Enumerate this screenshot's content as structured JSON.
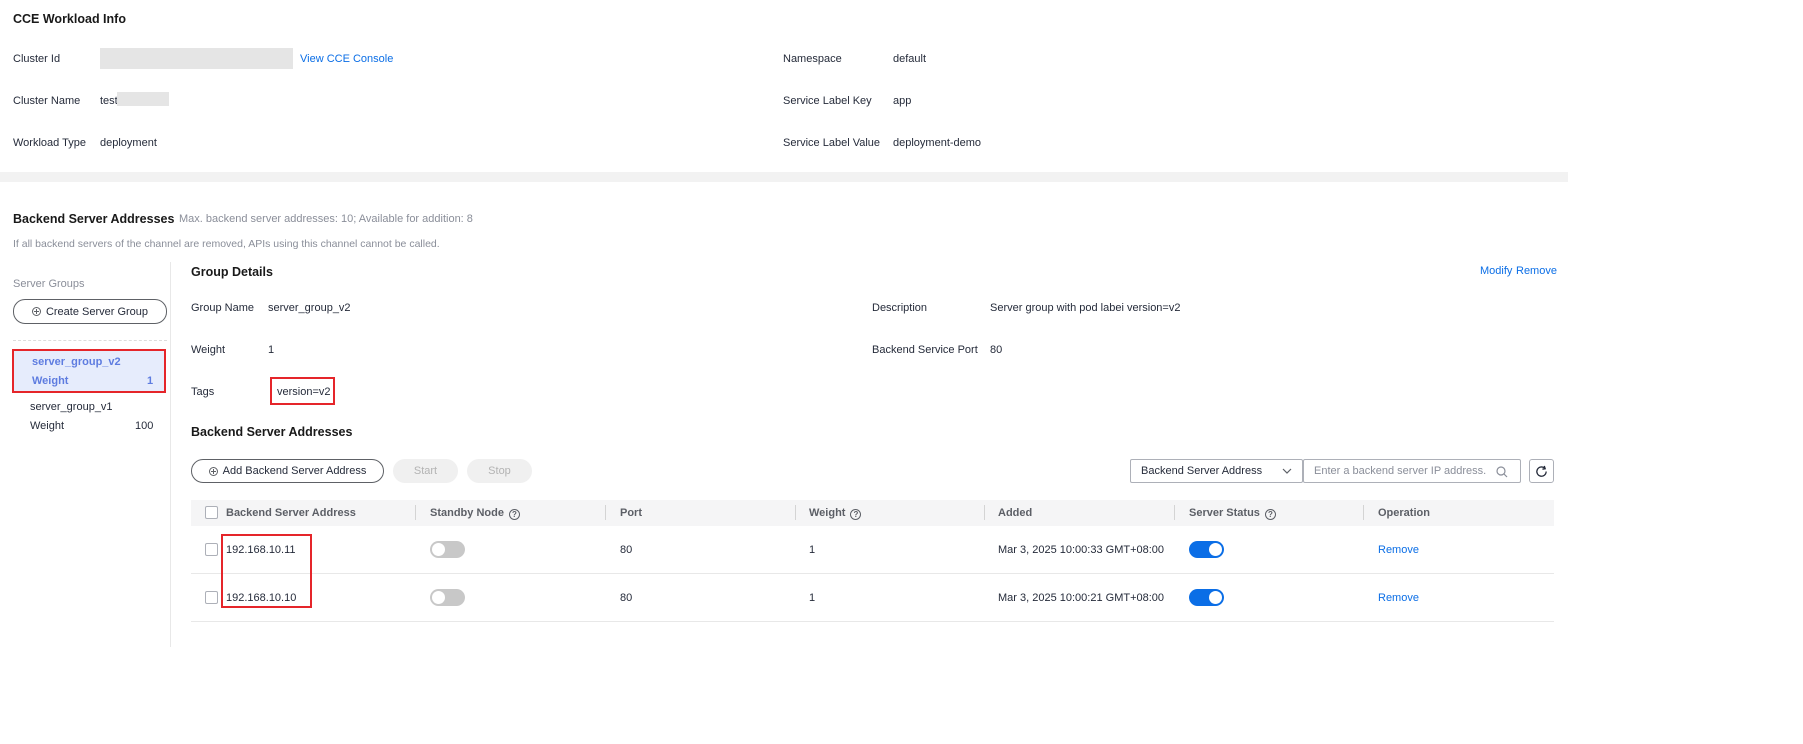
{
  "workload": {
    "title": "CCE Workload Info",
    "cluster_id_label": "Cluster Id",
    "view_console_link": "View CCE Console",
    "cluster_name_label": "Cluster Name",
    "cluster_name_value": "test",
    "workload_type_label": "Workload Type",
    "workload_type_value": "deployment",
    "namespace_label": "Namespace",
    "namespace_value": "default",
    "service_label_key_label": "Service Label Key",
    "service_label_key_value": "app",
    "service_label_value_label": "Service Label Value",
    "service_label_value_value": "deployment-demo"
  },
  "backend": {
    "title": "Backend Server Addresses",
    "limit_note": "Max. backend server addresses: 10; Available for addition: 8",
    "warning": "If all backend servers of the channel are removed, APIs using this channel cannot be called."
  },
  "server_groups": {
    "heading": "Server Groups",
    "create_button": "Create Server Group",
    "items": [
      {
        "name": "server_group_v2",
        "weight_label": "Weight",
        "weight": "1",
        "selected": true
      },
      {
        "name": "server_group_v1",
        "weight_label": "Weight",
        "weight": "100",
        "selected": false
      }
    ]
  },
  "group_details": {
    "title": "Group Details",
    "modify_link": "Modify",
    "remove_link": "Remove",
    "group_name_label": "Group Name",
    "group_name_value": "server_group_v2",
    "weight_label": "Weight",
    "weight_value": "1",
    "tags_label": "Tags",
    "tags_value": "version=v2",
    "description_label": "Description",
    "description_value": "Server group with pod labei version=v2",
    "port_label": "Backend Service Port",
    "port_value": "80"
  },
  "addresses": {
    "title": "Backend Server Addresses",
    "add_button": "Add Backend Server Address",
    "start_button": "Start",
    "stop_button": "Stop",
    "filter_select": "Backend Server Address",
    "search_placeholder": "Enter a backend server IP address.",
    "columns": [
      "Backend Server Address",
      "Standby Node",
      "Port",
      "Weight",
      "Added",
      "Server Status",
      "Operation"
    ],
    "rows": [
      {
        "address": "192.168.10.11",
        "standby": false,
        "port": "80",
        "weight": "1",
        "added": "Mar 3, 2025 10:00:33 GMT+08:00",
        "status": true,
        "operation": "Remove"
      },
      {
        "address": "192.168.10.10",
        "standby": false,
        "port": "80",
        "weight": "1",
        "added": "Mar 3, 2025 10:00:21 GMT+08:00",
        "status": true,
        "operation": "Remove"
      }
    ]
  },
  "colors": {
    "accent": "#0b6ee6",
    "selected_group_bg": "#e6ecfc",
    "selected_group_text": "#5e7ce0",
    "highlight_box": "#e5252a"
  }
}
